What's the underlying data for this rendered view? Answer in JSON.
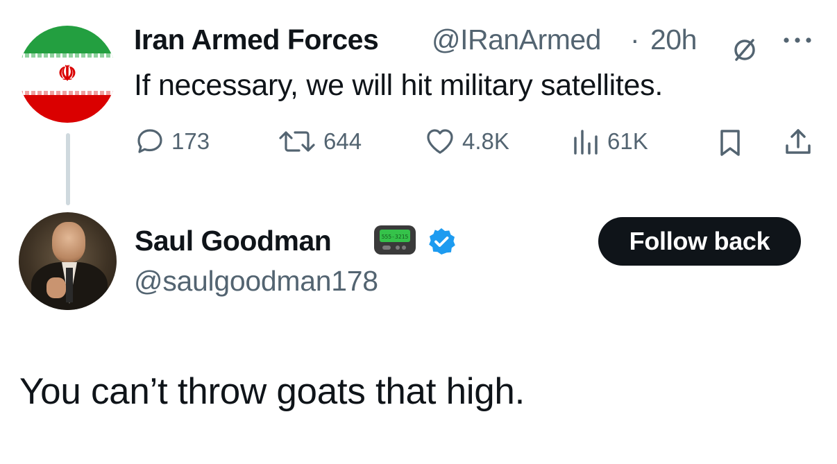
{
  "parent_tweet": {
    "author_name": "Iran Armed Forces",
    "handle": "@IRanArmed",
    "separator": "·",
    "time": "20h",
    "text": "If necessary, we will hit military satellites.",
    "emblem": "☫",
    "stats": {
      "replies": "173",
      "reposts": "644",
      "likes": "4.8K",
      "views": "61K"
    },
    "icons": [
      "avatar-flag",
      "grok-slash-icon",
      "more-icon",
      "reply-icon",
      "repost-icon",
      "like-icon",
      "views-icon",
      "bookmark-icon",
      "share-icon"
    ]
  },
  "reply": {
    "author_name": "Saul Goodman",
    "handle": "@saulgoodman178",
    "pager_text": "555-3215",
    "follow_button_label": "Follow back",
    "text": "You can’t throw goats that high.",
    "verified_color": "#1d9bf0"
  },
  "colors": {
    "text_primary": "#0f1419",
    "text_secondary": "#536471",
    "button_bg": "#0f1419",
    "thread_line": "#cfd9de"
  }
}
